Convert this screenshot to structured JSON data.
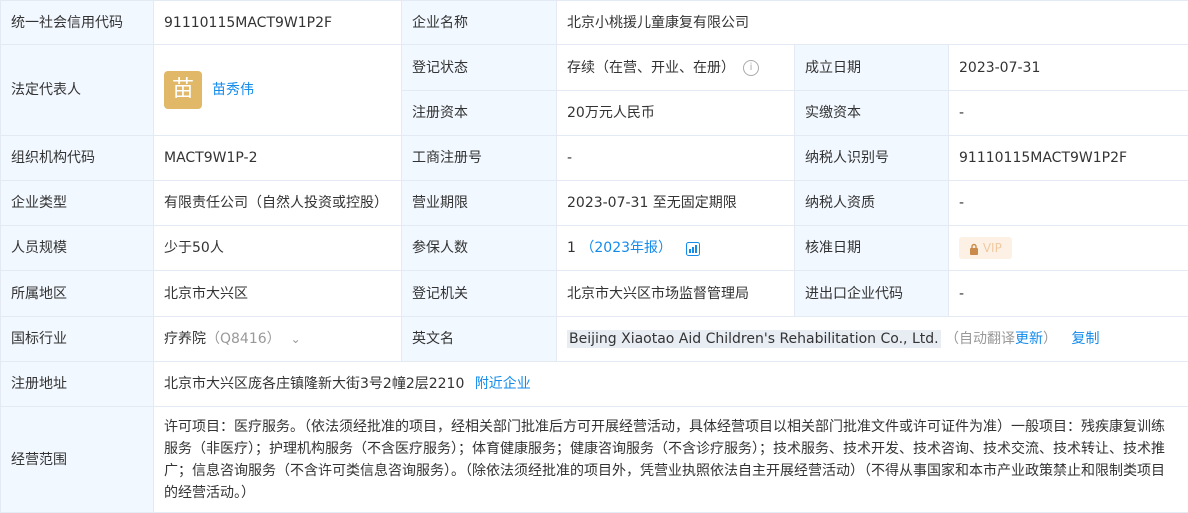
{
  "rows": {
    "credit_code": {
      "label": "统一社会信用代码",
      "value": "91110115MACT9W1P2F"
    },
    "company_name": {
      "label": "企业名称",
      "value": "北京小桃援儿童康复有限公司"
    },
    "legal_rep": {
      "label": "法定代表人",
      "avatar_char": "苗",
      "name": "苗秀伟"
    },
    "reg_status": {
      "label": "登记状态",
      "value": "存续（在营、开业、在册）"
    },
    "found_date": {
      "label": "成立日期",
      "value": "2023-07-31"
    },
    "reg_capital": {
      "label": "注册资本",
      "value": "20万元人民币"
    },
    "paid_capital": {
      "label": "实缴资本",
      "value": "-"
    },
    "org_code": {
      "label": "组织机构代码",
      "value": "MACT9W1P-2"
    },
    "biz_reg_no": {
      "label": "工商注册号",
      "value": "-"
    },
    "taxpayer_id": {
      "label": "纳税人识别号",
      "value": "91110115MACT9W1P2F"
    },
    "company_type": {
      "label": "企业类型",
      "value": "有限责任公司（自然人投资或控股）"
    },
    "biz_term": {
      "label": "营业期限",
      "value": "2023-07-31 至无固定期限"
    },
    "taxpayer_qual": {
      "label": "纳税人资质",
      "value": "-"
    },
    "staff_size": {
      "label": "人员规模",
      "value": "少于50人"
    },
    "insured": {
      "label": "参保人数",
      "value": "1",
      "report": "（2023年报）"
    },
    "approve_date": {
      "label": "核准日期",
      "vip": "VIP"
    },
    "region": {
      "label": "所属地区",
      "value": "北京市大兴区"
    },
    "reg_authority": {
      "label": "登记机关",
      "value": "北京市大兴区市场监督管理局"
    },
    "import_export": {
      "label": "进出口企业代码",
      "value": "-"
    },
    "industry": {
      "label": "国标行业",
      "value": "疗养院",
      "code": "（Q8416）"
    },
    "english_name": {
      "label": "英文名",
      "value": "Beijing Xiaotao Aid Children's Rehabilitation Co., Ltd.",
      "auto_note": "（自动翻译",
      "update": "更新",
      "close_paren": "）",
      "copy": "复制"
    },
    "address": {
      "label": "注册地址",
      "value": "北京市大兴区庞各庄镇隆新大街3号2幢2层2210",
      "nearby": "附近企业"
    },
    "scope": {
      "label": "经营范围",
      "value": "许可项目：医疗服务。（依法须经批准的项目，经相关部门批准后方可开展经营活动，具体经营项目以相关部门批准文件或许可证件为准）一般项目：残疾康复训练服务（非医疗）；护理机构服务（不含医疗服务）；体育健康服务；健康咨询服务（不含诊疗服务）；技术服务、技术开发、技术咨询、技术交流、技术转让、技术推广；信息咨询服务（不含许可类信息咨询服务）。（除依法须经批准的项目外，凭营业执照依法自主开展经营活动）（不得从事国家和本市产业政策禁止和限制类项目的经营活动。）"
    }
  }
}
